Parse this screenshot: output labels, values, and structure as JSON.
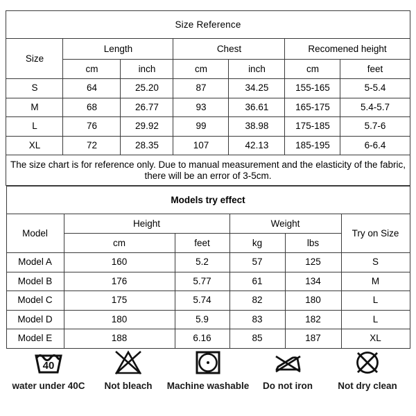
{
  "size_reference": {
    "title": "Size Reference",
    "group_headers": [
      {
        "label": "Size",
        "color": "#ffffff"
      },
      {
        "label": "Length",
        "color": "#efefef"
      },
      {
        "label": "Chest",
        "color": "#d9e1f2"
      },
      {
        "label": "Recomened height",
        "color": "#f8cbad"
      }
    ],
    "unit_headers": {
      "length_cm": "cm",
      "length_inch": "inch",
      "chest_cm": "cm",
      "chest_inch": "inch",
      "height_cm": "cm",
      "height_feet": "feet"
    },
    "rows": [
      {
        "size": "S",
        "length_cm": "64",
        "length_inch": "25.20",
        "chest_cm": "87",
        "chest_inch": "34.25",
        "height_cm": "155-165",
        "height_feet": "5-5.4"
      },
      {
        "size": "M",
        "length_cm": "68",
        "length_inch": "26.77",
        "chest_cm": "93",
        "chest_inch": "36.61",
        "height_cm": "165-175",
        "height_feet": "5.4-5.7"
      },
      {
        "size": "L",
        "length_cm": "76",
        "length_inch": "29.92",
        "chest_cm": "99",
        "chest_inch": "38.98",
        "height_cm": "175-185",
        "height_feet": "5.7-6"
      },
      {
        "size": "XL",
        "length_cm": "72",
        "length_inch": "28.35",
        "chest_cm": "107",
        "chest_inch": "42.13",
        "height_cm": "185-195",
        "height_feet": "6-6.4"
      }
    ],
    "disclaimer": "The size chart is for reference only. Due to manual measurement and the elasticity of the fabric, there will be an error of 3-5cm."
  },
  "models_try_effect": {
    "title": "Models try effect",
    "group_headers": [
      {
        "label": "Model",
        "color": "#ffffff"
      },
      {
        "label": "Height",
        "color": "#efefef"
      },
      {
        "label": "Weight",
        "color": "#fbe5c6"
      },
      {
        "label": "Try on Size",
        "color": "#c6e0b4"
      }
    ],
    "unit_headers": {
      "height_cm": "cm",
      "height_feet": "feet",
      "weight_kg": "kg",
      "weight_lbs": "lbs"
    },
    "rows": [
      {
        "model": "Model A",
        "height_cm": "160",
        "height_feet": "5.2",
        "weight_kg": "57",
        "weight_lbs": "125",
        "try_on_size": "S"
      },
      {
        "model": "Model B",
        "height_cm": "176",
        "height_feet": "5.77",
        "weight_kg": "61",
        "weight_lbs": "134",
        "try_on_size": "M"
      },
      {
        "model": "Model C",
        "height_cm": "175",
        "height_feet": "5.74",
        "weight_kg": "82",
        "weight_lbs": "180",
        "try_on_size": "L"
      },
      {
        "model": "Model D",
        "height_cm": "180",
        "height_feet": "5.9",
        "weight_kg": "83",
        "weight_lbs": "182",
        "try_on_size": "L"
      },
      {
        "model": "Model E",
        "height_cm": "188",
        "height_feet": "6.16",
        "weight_kg": "85",
        "weight_lbs": "187",
        "try_on_size": "XL"
      }
    ]
  },
  "care_symbols": [
    {
      "icon": "wash-tub-40-icon",
      "caption": "water under 40C"
    },
    {
      "icon": "no-bleach-triangle-icon",
      "caption": "Not bleach"
    },
    {
      "icon": "machine-washable-icon",
      "caption": "Machine washable"
    },
    {
      "icon": "do-not-iron-icon",
      "caption": "Do not iron"
    },
    {
      "icon": "no-dry-clean-icon",
      "caption": "Not dry clean"
    }
  ],
  "colors": {
    "green_header": "#c5e0b4",
    "grey": "#efefef",
    "blue": "#d9e1f2",
    "peach": "#f8cbad",
    "yellow_banner": "#ffc000",
    "cream": "#fbe5c6",
    "green_light": "#c6e0b4",
    "border": "#3a3a3a"
  },
  "wash_temperature_label": "40"
}
